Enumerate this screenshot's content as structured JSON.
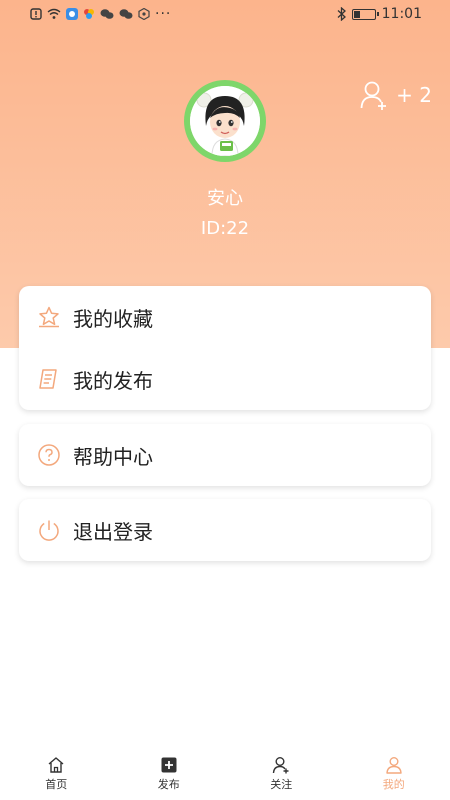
{
  "status_bar": {
    "dots": "···",
    "time": "11:01",
    "battery_level": 0.3
  },
  "profile": {
    "follow_count": "+ 2",
    "name": "安心",
    "id_text": "ID:22"
  },
  "menu": {
    "favorites": "我的收藏",
    "my_posts": "我的发布",
    "help": "帮助中心",
    "logout": "退出登录"
  },
  "tabs": [
    {
      "label": "首页",
      "icon": "home-icon"
    },
    {
      "label": "发布",
      "icon": "plus-square-icon"
    },
    {
      "label": "关注",
      "icon": "user-plus-icon"
    },
    {
      "label": "我的",
      "icon": "user-icon"
    }
  ],
  "colors": {
    "header_top": "#fcb48c",
    "header_bottom": "#fdcaab",
    "accent": "#f3a87d",
    "avatar_ring": "#7ed66a"
  }
}
